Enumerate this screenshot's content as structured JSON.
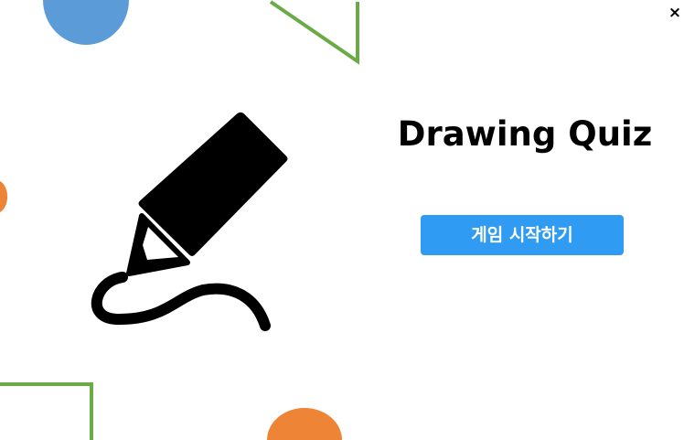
{
  "app": {
    "title": "Drawing Quiz",
    "start_button_label": "게임 시작하기",
    "close_label": "×"
  },
  "icons": {
    "close": "close-icon",
    "hero": "pencil-drawing-icon"
  },
  "colors": {
    "background": "#ffffff",
    "primary_button": "#2f9bf2",
    "primary_button_text": "#ffffff",
    "title_text": "#000000",
    "decor_blue": "#5a9bd8",
    "decor_orange": "#ee8435",
    "decor_green": "#6aab47"
  }
}
